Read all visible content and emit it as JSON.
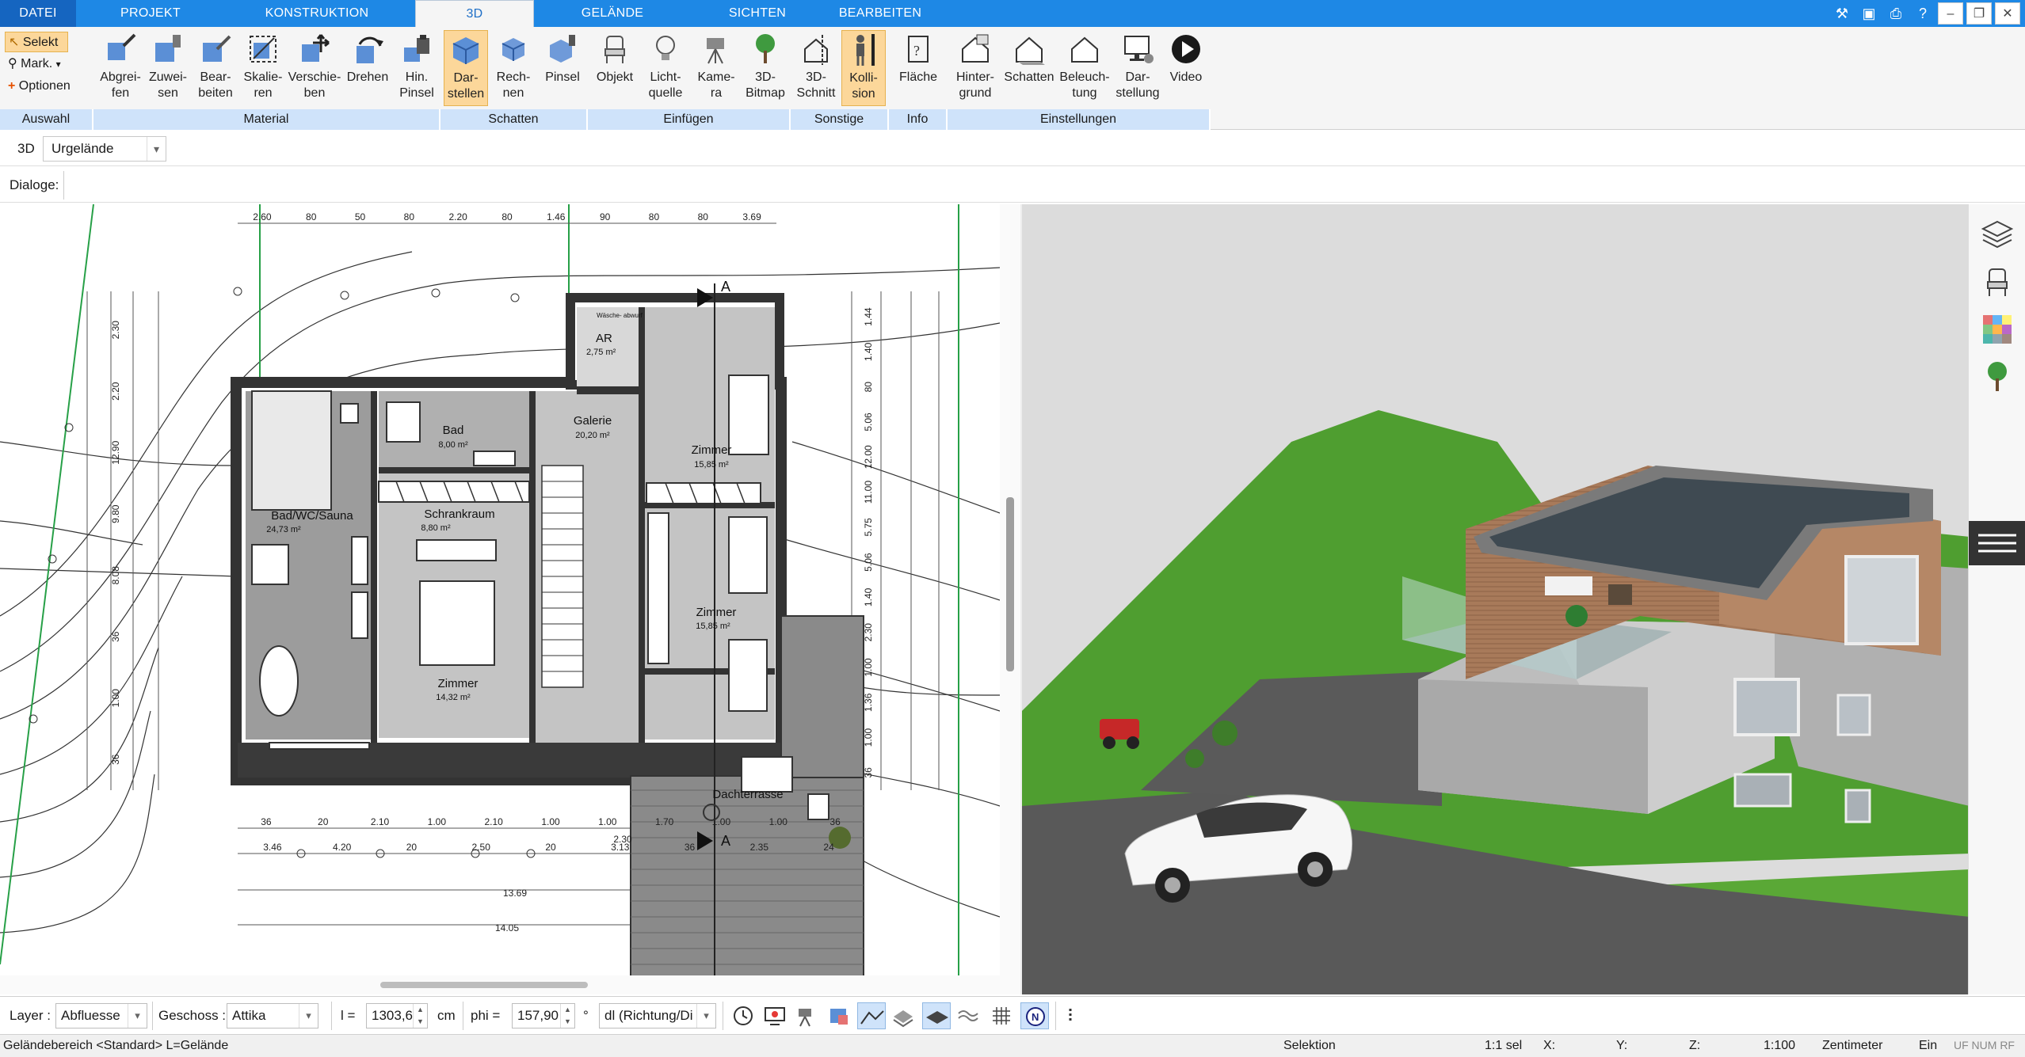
{
  "menu": {
    "tabs": [
      "DATEI",
      "PROJEKT",
      "KONSTRUKTION",
      "3D",
      "GELÄNDE",
      "SICHTEN",
      "BEARBEITEN"
    ],
    "active": "3D"
  },
  "ribbon": {
    "auswahl": {
      "label": "Auswahl",
      "selekt": "Selekt",
      "mark": "Mark.",
      "optionen": "Optionen"
    },
    "material": {
      "label": "Material",
      "buttons": [
        "Abgrei-\nfen",
        "Zuwei-\nsen",
        "Bear-\nbeiten",
        "Skalie-\nren",
        "Verschie-\nben",
        "Drehen",
        "Hin.\nPinsel"
      ]
    },
    "schatten": {
      "label": "Schatten",
      "buttons": [
        "Dar-\nstellen",
        "Rech-\nnen",
        "Pinsel"
      ]
    },
    "einfuegen": {
      "label": "Einfügen",
      "buttons": [
        "Objekt",
        "Licht-\nquelle",
        "Kame-\nra",
        "3D-\nBitmap"
      ]
    },
    "sonstige": {
      "label": "Sonstige",
      "buttons": [
        "3D-\nSchnitt",
        "Kolli-\nsion"
      ]
    },
    "info": {
      "label": "Info",
      "buttons": [
        "Fläche"
      ]
    },
    "einstellungen": {
      "label": "Einstellungen",
      "buttons": [
        "Hinter-\ngrund",
        "Schatten",
        "Beleuch-\ntung",
        "Dar-\nstellung",
        "Video"
      ]
    }
  },
  "bar3d": {
    "label": "3D",
    "terrain_select": "Urgelände"
  },
  "dialoge": {
    "label": "Dialoge:"
  },
  "plan": {
    "rooms": [
      {
        "name": "Bad",
        "area": "8,00 m²"
      },
      {
        "name": "Galerie",
        "area": "20,20 m²"
      },
      {
        "name": "Zimmer",
        "area": "15,85 m²"
      },
      {
        "name": "AR",
        "area": "2,75 m²"
      },
      {
        "name": "Bad/WC/Sauna",
        "area": "24,73 m²"
      },
      {
        "name": "Schrankraum",
        "area": "8,80 m²"
      },
      {
        "name": "Zimmer",
        "area": "15,85 m²"
      },
      {
        "name": "Zimmer",
        "area": "14,32 m²"
      },
      {
        "name": "Dachterrasse",
        "area": ""
      }
    ],
    "laundry": "Wäsche-\nabwurf",
    "top_dims": [
      "2.60",
      "80",
      "50",
      "80",
      "2.20",
      "80",
      "1.46",
      "90",
      "80",
      "80",
      "3.69"
    ],
    "bottom_dims_1": [
      "36",
      "20",
      "2.10",
      "1.00",
      "2.10",
      "1.00",
      "1.00",
      "1.70",
      "1.00",
      "1.00",
      "36"
    ],
    "bottom_dims_2": [
      "3.46",
      "4.20",
      "20",
      "2.50",
      "20",
      "3.13",
      "36",
      "2.35",
      "24"
    ],
    "total_1": "13.69",
    "total_2": "14.05",
    "extra_dims": [
      "2.30"
    ],
    "left_dims": [
      "2.30",
      "2.20",
      "12.90",
      "9.80",
      "8.08",
      "36",
      "1.00",
      "36"
    ],
    "right_dims": [
      "1.44",
      "1.40",
      "80",
      "5.06",
      "12.00",
      "11.00",
      "5.75",
      "5.06",
      "1.40",
      "2.30",
      "1.00",
      "1.36",
      "1.00",
      "36"
    ],
    "section_marker": "A"
  },
  "bottombar": {
    "layer_label": "Layer :",
    "layer_value": "Abfluesse",
    "geschoss_label": "Geschoss :",
    "geschoss_value": "Attika",
    "l_label": "l =",
    "l_value": "1303,6",
    "l_unit": "cm",
    "phi_label": "phi =",
    "phi_value": "157,90",
    "phi_unit": "°",
    "dl_value": "dl (Richtung/Di"
  },
  "statusbar": {
    "left": "Geländebereich <Standard> L=Gelände",
    "mode": "Selektion",
    "sel": "1:1 sel",
    "x": "X:",
    "y": "Y:",
    "z": "Z:",
    "scale": "1:100",
    "unit": "Zentimeter",
    "ein": "Ein",
    "flags": "UF NUM RF"
  },
  "colors": {
    "ribbon_blue": "#1e88e5",
    "group_label": "#cfe3fa",
    "active_button": "#fcd79a",
    "grass": "#4a9a2e",
    "roof": "#3f4a52",
    "wood": "#a87a5a"
  }
}
